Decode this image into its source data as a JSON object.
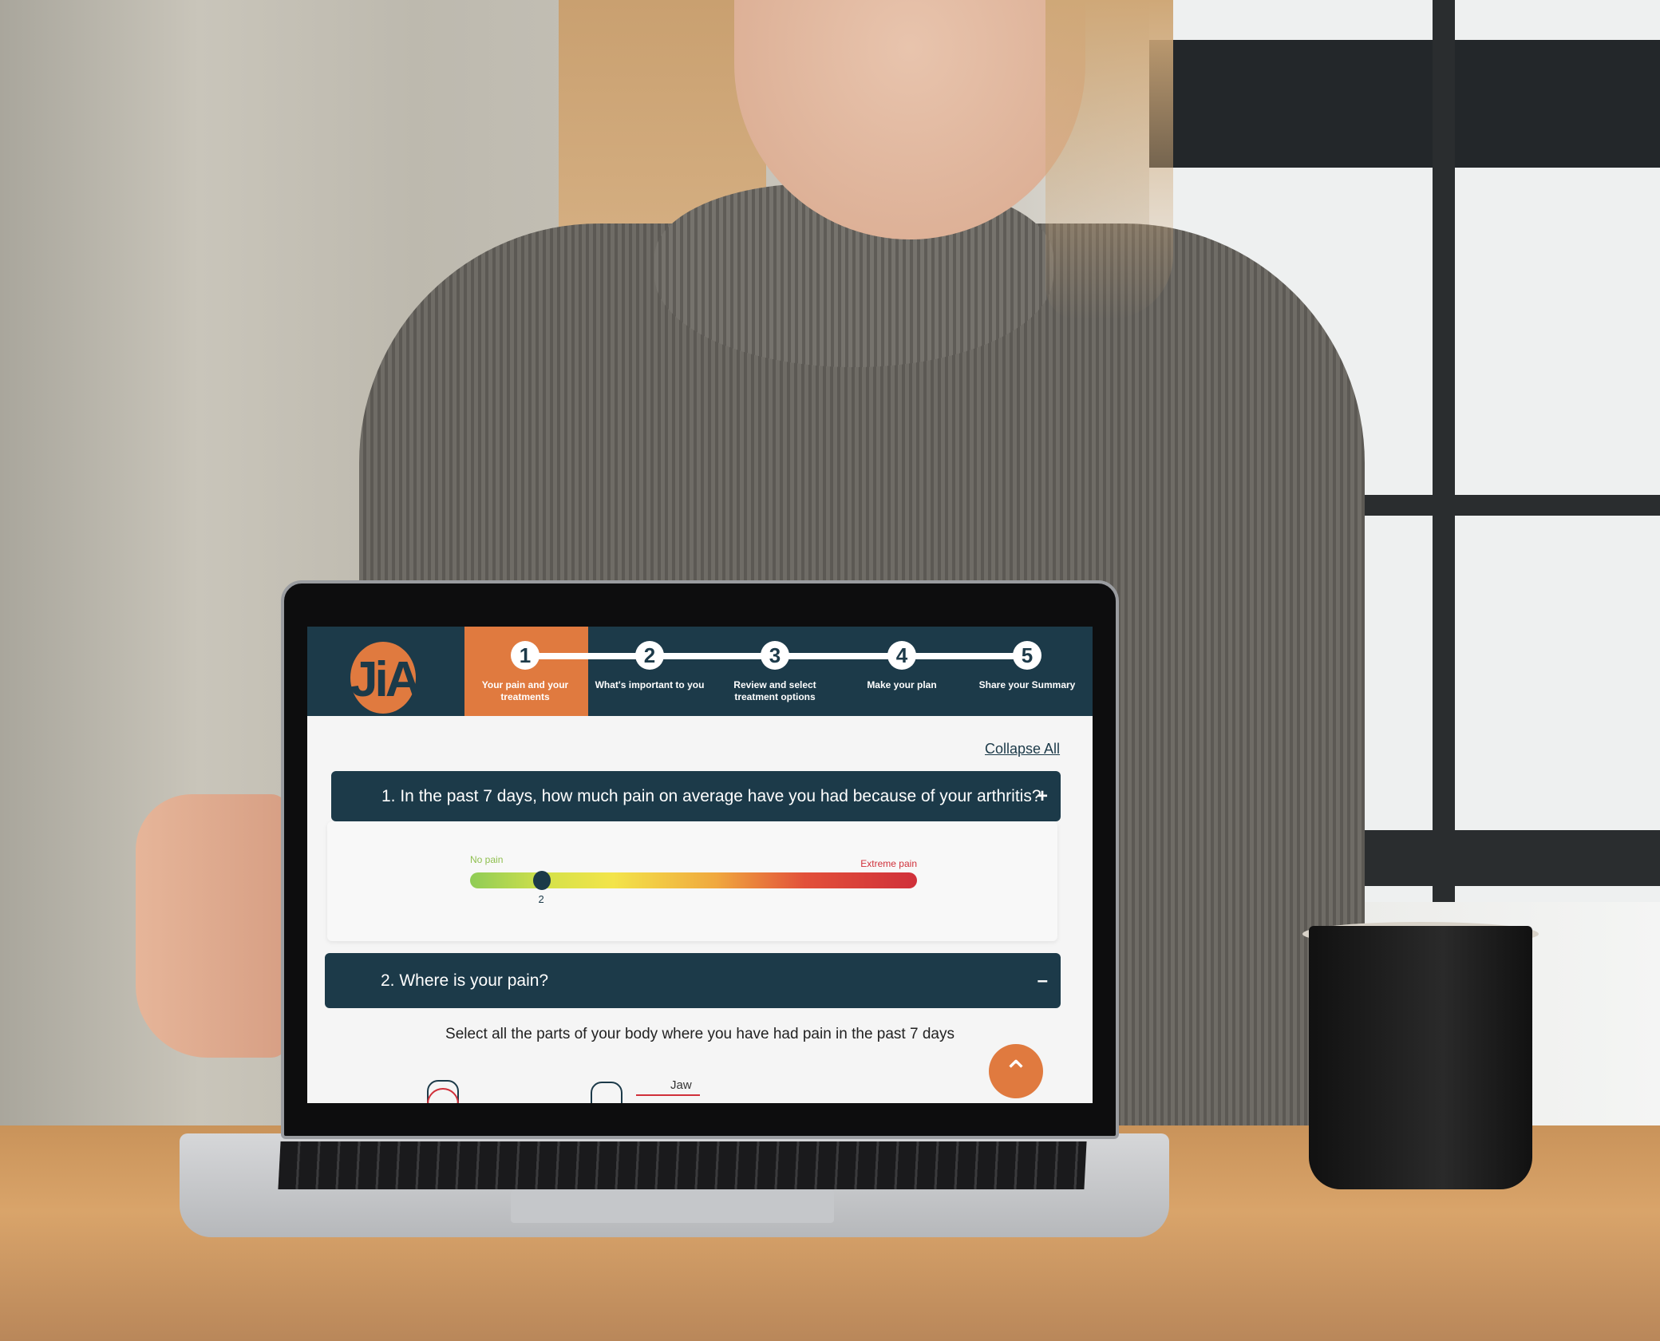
{
  "app": {
    "logo_text": "JiA",
    "accent": "#e07a3f",
    "primary": "#1c3a49"
  },
  "steps": [
    {
      "number": "1",
      "label": "Your pain and your treatments",
      "active": true
    },
    {
      "number": "2",
      "label": "What's important to you",
      "active": false
    },
    {
      "number": "3",
      "label": "Review and select treatment options",
      "active": false
    },
    {
      "number": "4",
      "label": "Make your plan",
      "active": false
    },
    {
      "number": "5",
      "label": "Share your Summary",
      "active": false
    }
  ],
  "collapse_all": "Collapse All",
  "questions": [
    {
      "title": "1. In the past 7 days, how much pain on average have you had because of your arthritis?",
      "toggle": "+",
      "slider": {
        "min_label": "No pain",
        "max_label": "Extreme pain",
        "value": "2",
        "min": 0,
        "max": 10
      }
    },
    {
      "title": "2. Where is your pain?",
      "toggle": "–",
      "instruction": "Select all the parts of your body where you have had pain in the past 7 days",
      "body_label": "Jaw"
    }
  ],
  "scroll_top_icon": "chevron-up-icon"
}
